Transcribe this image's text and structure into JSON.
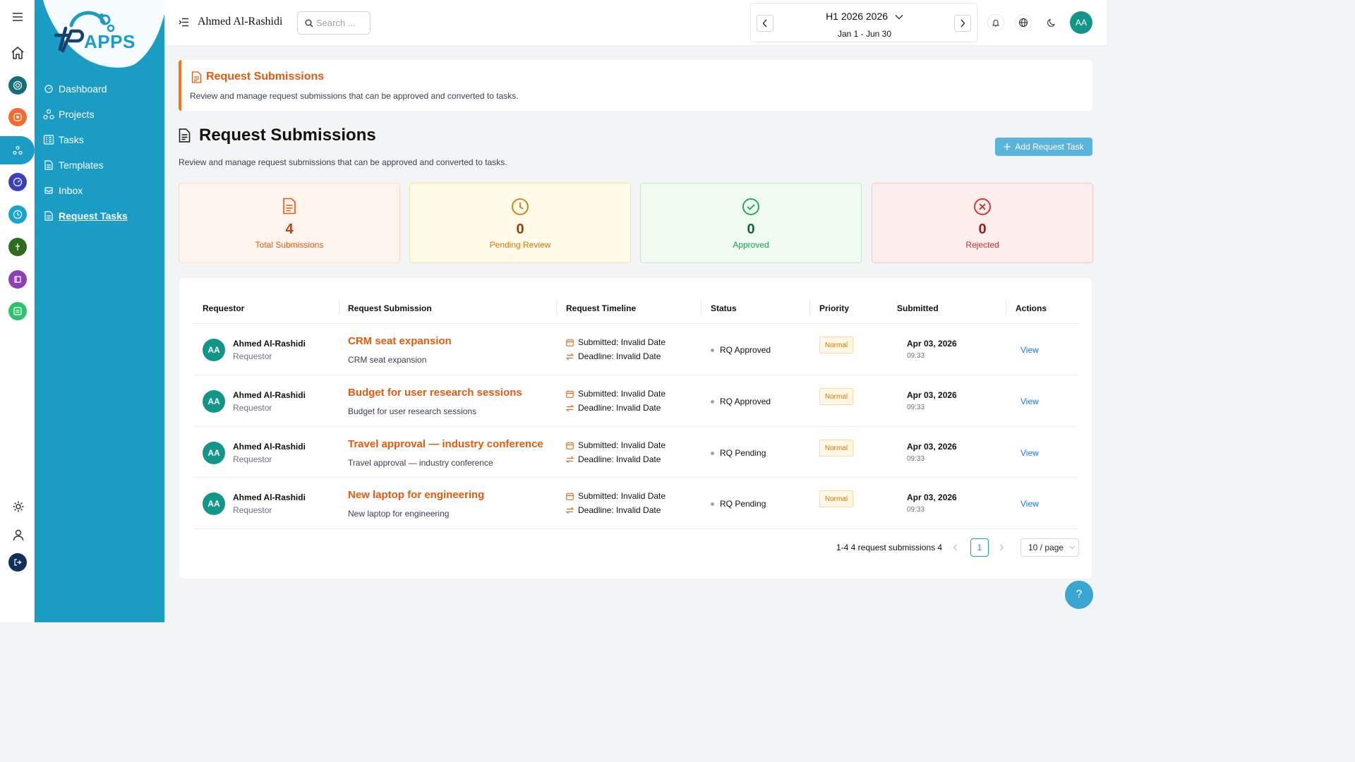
{
  "header": {
    "user_name": "Ahmed Al-Rashidi",
    "search_placeholder": "Search ...",
    "period_title": "H1 2026 2026",
    "period_range": "Jan 1 - Jun 30",
    "avatar_initials": "AA"
  },
  "logo": {
    "text": "APPS"
  },
  "sidebar": {
    "items": [
      {
        "label": "Dashboard",
        "icon": "dashboard-icon"
      },
      {
        "label": "Projects",
        "icon": "projects-icon"
      },
      {
        "label": "Tasks",
        "icon": "tasks-icon"
      },
      {
        "label": "Templates",
        "icon": "templates-icon"
      },
      {
        "label": "Inbox",
        "icon": "inbox-icon"
      },
      {
        "label": "Request Tasks",
        "icon": "request-tasks-icon",
        "active": true
      }
    ]
  },
  "banner": {
    "title": "Request Submissions",
    "description": "Review and manage request submissions that can be approved and converted to tasks."
  },
  "page": {
    "title": "Request Submissions",
    "description": "Review and manage request submissions that can be approved and converted to tasks.",
    "add_button": "Add Request Task"
  },
  "stats": [
    {
      "value": "4",
      "label": "Total Submissions",
      "color": "#ea580c"
    },
    {
      "value": "0",
      "label": "Pending Review",
      "color": "#d97706"
    },
    {
      "value": "0",
      "label": "Approved",
      "color": "#16a34a"
    },
    {
      "value": "0",
      "label": "Rejected",
      "color": "#dc2626"
    }
  ],
  "table": {
    "columns": [
      "Requestor",
      "Request Submission",
      "Request Timeline",
      "Status",
      "Priority",
      "Submitted",
      "Actions"
    ],
    "rows": [
      {
        "initials": "AA",
        "name": "Ahmed Al-Rashidi",
        "role": "Requestor",
        "title": "CRM seat expansion",
        "desc": "CRM seat expansion",
        "submitted": "Submitted: Invalid Date",
        "deadline": "Deadline: Invalid Date",
        "status": "RQ Approved",
        "priority": "Normal",
        "date": "Apr 03, 2026",
        "time": "09:33",
        "action": "View"
      },
      {
        "initials": "AA",
        "name": "Ahmed Al-Rashidi",
        "role": "Requestor",
        "title": "Budget for user research sessions",
        "desc": "Budget for user research sessions",
        "submitted": "Submitted: Invalid Date",
        "deadline": "Deadline: Invalid Date",
        "status": "RQ Approved",
        "priority": "Normal",
        "date": "Apr 03, 2026",
        "time": "09:33",
        "action": "View"
      },
      {
        "initials": "AA",
        "name": "Ahmed Al-Rashidi",
        "role": "Requestor",
        "title": "Travel approval — industry conference",
        "desc": "Travel approval — industry conference",
        "submitted": "Submitted: Invalid Date",
        "deadline": "Deadline: Invalid Date",
        "status": "RQ Pending",
        "priority": "Normal",
        "date": "Apr 03, 2026",
        "time": "09:33",
        "action": "View"
      },
      {
        "initials": "AA",
        "name": "Ahmed Al-Rashidi",
        "role": "Requestor",
        "title": "New laptop for engineering",
        "desc": "New laptop for engineering",
        "submitted": "Submitted: Invalid Date",
        "deadline": "Deadline: Invalid Date",
        "status": "RQ Pending",
        "priority": "Normal",
        "date": "Apr 03, 2026",
        "time": "09:33",
        "action": "View"
      }
    ]
  },
  "pagination": {
    "summary": "1-4 4 request submissions 4",
    "current_page": "1",
    "page_size": "10 / page"
  },
  "help": {
    "label": "?"
  }
}
